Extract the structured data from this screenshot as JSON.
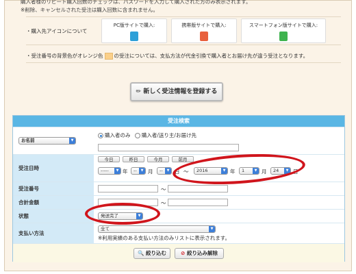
{
  "notes": {
    "line1": "購入者様のリピート購入回数のチェックは、パスワードを入力して購入された方のみ表示されます。",
    "line2": "※削除、キャンセルされた受注は購入回数に含まれません。",
    "icon_label": "購入先アイコンについて",
    "pc": "PC版サイトで購入:",
    "mobile": "携帯版サイトで購入:",
    "smartphone": "スマートフォン版サイトで購入:",
    "footnote_pre": "受注番号の背景色がオレンジ色",
    "footnote_post": "の受注については、支払方法が代金引換で購入者とお届け先が違う受注となります。"
  },
  "register_button": "新しく受注情報を登録する",
  "panel": {
    "title": "受注検索",
    "name_select": "お名前",
    "radio_buyer_only": "購入者のみ",
    "radio_buyer_or_ship": "購入者/送り主/お届け先",
    "order_date": {
      "label": "受注日時",
      "quick": [
        "今日",
        "昨日",
        "今月",
        "前月"
      ],
      "from_year": "-----",
      "from_month": "--",
      "from_day": "--",
      "year_unit": "年",
      "month_unit": "月",
      "day_unit": "日",
      "tilde": "〜",
      "to_year": "2016",
      "to_month": "1",
      "to_day": "24"
    },
    "order_number": {
      "label": "受注番号",
      "tilde": "〜"
    },
    "total": {
      "label": "合計金額",
      "tilde": "〜"
    },
    "status": {
      "label": "状態",
      "value": "発送完了"
    },
    "payment": {
      "label": "支払い方法",
      "value": "全て",
      "note": "※利用実績のある支払い方法のみリストに表示されます。"
    },
    "search_button": "絞り込む",
    "clear_button": "絞り込み解除"
  },
  "colors": {
    "highlight": "#d0151c",
    "header": "#5ab6e4",
    "label_bg": "#d3eaf7"
  }
}
